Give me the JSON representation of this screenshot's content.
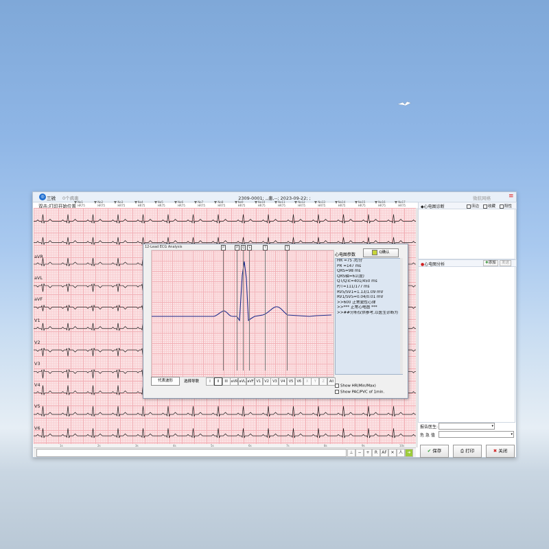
{
  "window": {
    "tabs": [
      "三锐",
      "0个病患"
    ],
    "title": "2309-0001; ,,患,--; 2023-09-22; ;",
    "serial": "微航网络",
    "hint": "双击:打印开始位置"
  },
  "beats": [
    {
      "no": "No1",
      "hr": "HR75"
    },
    {
      "no": "No2",
      "hr": "HR75"
    },
    {
      "no": "No3",
      "hr": "HR75"
    },
    {
      "no": "No4",
      "hr": "HR75"
    },
    {
      "no": "No5",
      "hr": "HR75"
    },
    {
      "no": "No6",
      "hr": "HR75"
    },
    {
      "no": "No7",
      "hr": "HR75"
    },
    {
      "no": "No8",
      "hr": "HR75"
    },
    {
      "no": "No9",
      "hr": "HR75"
    },
    {
      "no": "No10",
      "hr": "HR75"
    },
    {
      "no": "No11",
      "hr": "HR75"
    },
    {
      "no": "No12",
      "hr": "HR75"
    },
    {
      "no": "No13",
      "hr": "HR75"
    },
    {
      "no": "No14",
      "hr": "HR75"
    },
    {
      "no": "No15",
      "hr": "HR75"
    },
    {
      "no": "No16",
      "hr": "HR75"
    },
    {
      "no": "No17",
      "hr": "HR75"
    }
  ],
  "leads": [
    "aVR",
    "aVL",
    "aVF",
    "V1",
    "V2",
    "V3",
    "V4",
    "V5",
    "V6"
  ],
  "time_scale": [
    "1s",
    "2s",
    "3s",
    "4s",
    "5s",
    "6s",
    "7s",
    "8s",
    "9s",
    "10s"
  ],
  "toolbar_icons": [
    "lead-icon",
    "zoom-out-icon",
    "zoom-in-icon",
    "measure-icon",
    "AF",
    "grid-icon",
    "person-icon",
    "next-icon"
  ],
  "toolbar_labels": {
    "measure": "R",
    "af": "AF",
    "person": "人"
  },
  "diagnosis_panel": {
    "title": "心电图诊断",
    "checks": [
      "床边",
      "收藏",
      "阳性"
    ]
  },
  "analysis_panel": {
    "title": "心电图分析",
    "add": "添加",
    "send": "发送"
  },
  "form": {
    "doctor_label": "报告医生:",
    "urgency_label": "危 急 值",
    "save": "保存",
    "print": "打印",
    "close": "关闭"
  },
  "dialog": {
    "title": "12-Lead ECG Analysis",
    "params_title": "心电图参数",
    "ok": "Q确认",
    "params": [
      "HR =75 次/分",
      "PR =147 ms",
      "QRS=98 ms",
      "QRS轴=61(度)",
      "QT/QTc=401/450 ms",
      "P/T=111/177 ms",
      "RV5/SV1=1.13/1.09 mV",
      "RV1/SV5=0.04/0.01 mV",
      ">>600 正常窦性心律",
      ">>*** 正常心电图 ***",
      ">>##分析仅供参考,以医生诊断为"
    ],
    "representative_btn": "代表波形",
    "select_label": "选择导联",
    "leads": [
      "I",
      "II",
      "III",
      "aVR",
      "aVL",
      "aVF",
      "V1",
      "V2",
      "V3",
      "V4",
      "V5",
      "V6",
      "X",
      "Y",
      "Z",
      "All"
    ],
    "markers": [
      "P",
      "P",
      "Q",
      "S",
      "T",
      "T"
    ],
    "options": [
      "Show HR(Min/Max)",
      "Show PAC/PVC of 1min."
    ]
  }
}
